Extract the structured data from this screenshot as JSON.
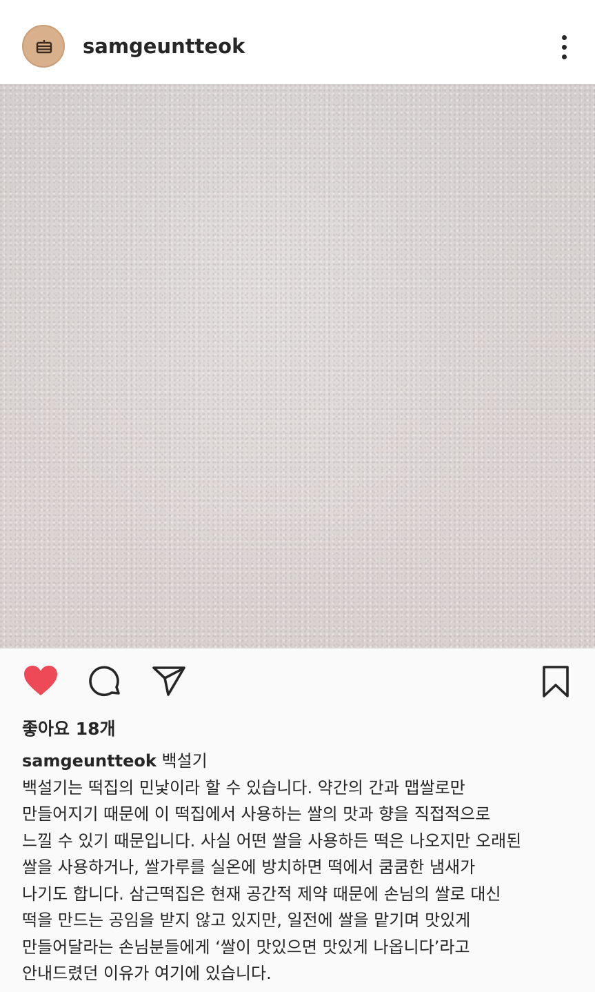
{
  "post": {
    "username": "samgeuntteok",
    "likes_text": "좋아요 18개",
    "caption_title": "백설기",
    "caption_lines": [
      "백설기는 떡집의 민낯이라 할 수 있습니다. 약간의 간과 맵쌀로만",
      "만들어지기 때문에 이 떡집에서 사용하는 쌀의 맛과 향을 직접적으로",
      "느낄 수 있기 때문입니다. 사실 어떤 쌀을 사용하든 떡은 나오지만 오래된",
      "쌀을 사용하거나, 쌀가루를 실온에 방치하면 떡에서 쿰쿰한 냄새가",
      "나기도 합니다. 삼근떡집은 현재 공간적 제약 때문에 손님의 쌀로 대신",
      "떡을 만드는 공임을 받지 않고 있지만, 일전에 쌀을 맡기며 맛있게",
      "만들어달라는 손님분들에게 ‘쌀이 맛있으면 맛있게 나옵니다’라고",
      "안내드렸던 이유가 여기에 있습니다."
    ]
  },
  "icons": {
    "avatar": "rice-cake-icon",
    "more": "more-options-icon",
    "like": "heart-icon",
    "comment": "comment-icon",
    "share": "send-icon",
    "save": "bookmark-icon"
  },
  "colors": {
    "like_red": "#ed4956",
    "text": "#262626",
    "avatar_bg": "#d8b08c"
  }
}
